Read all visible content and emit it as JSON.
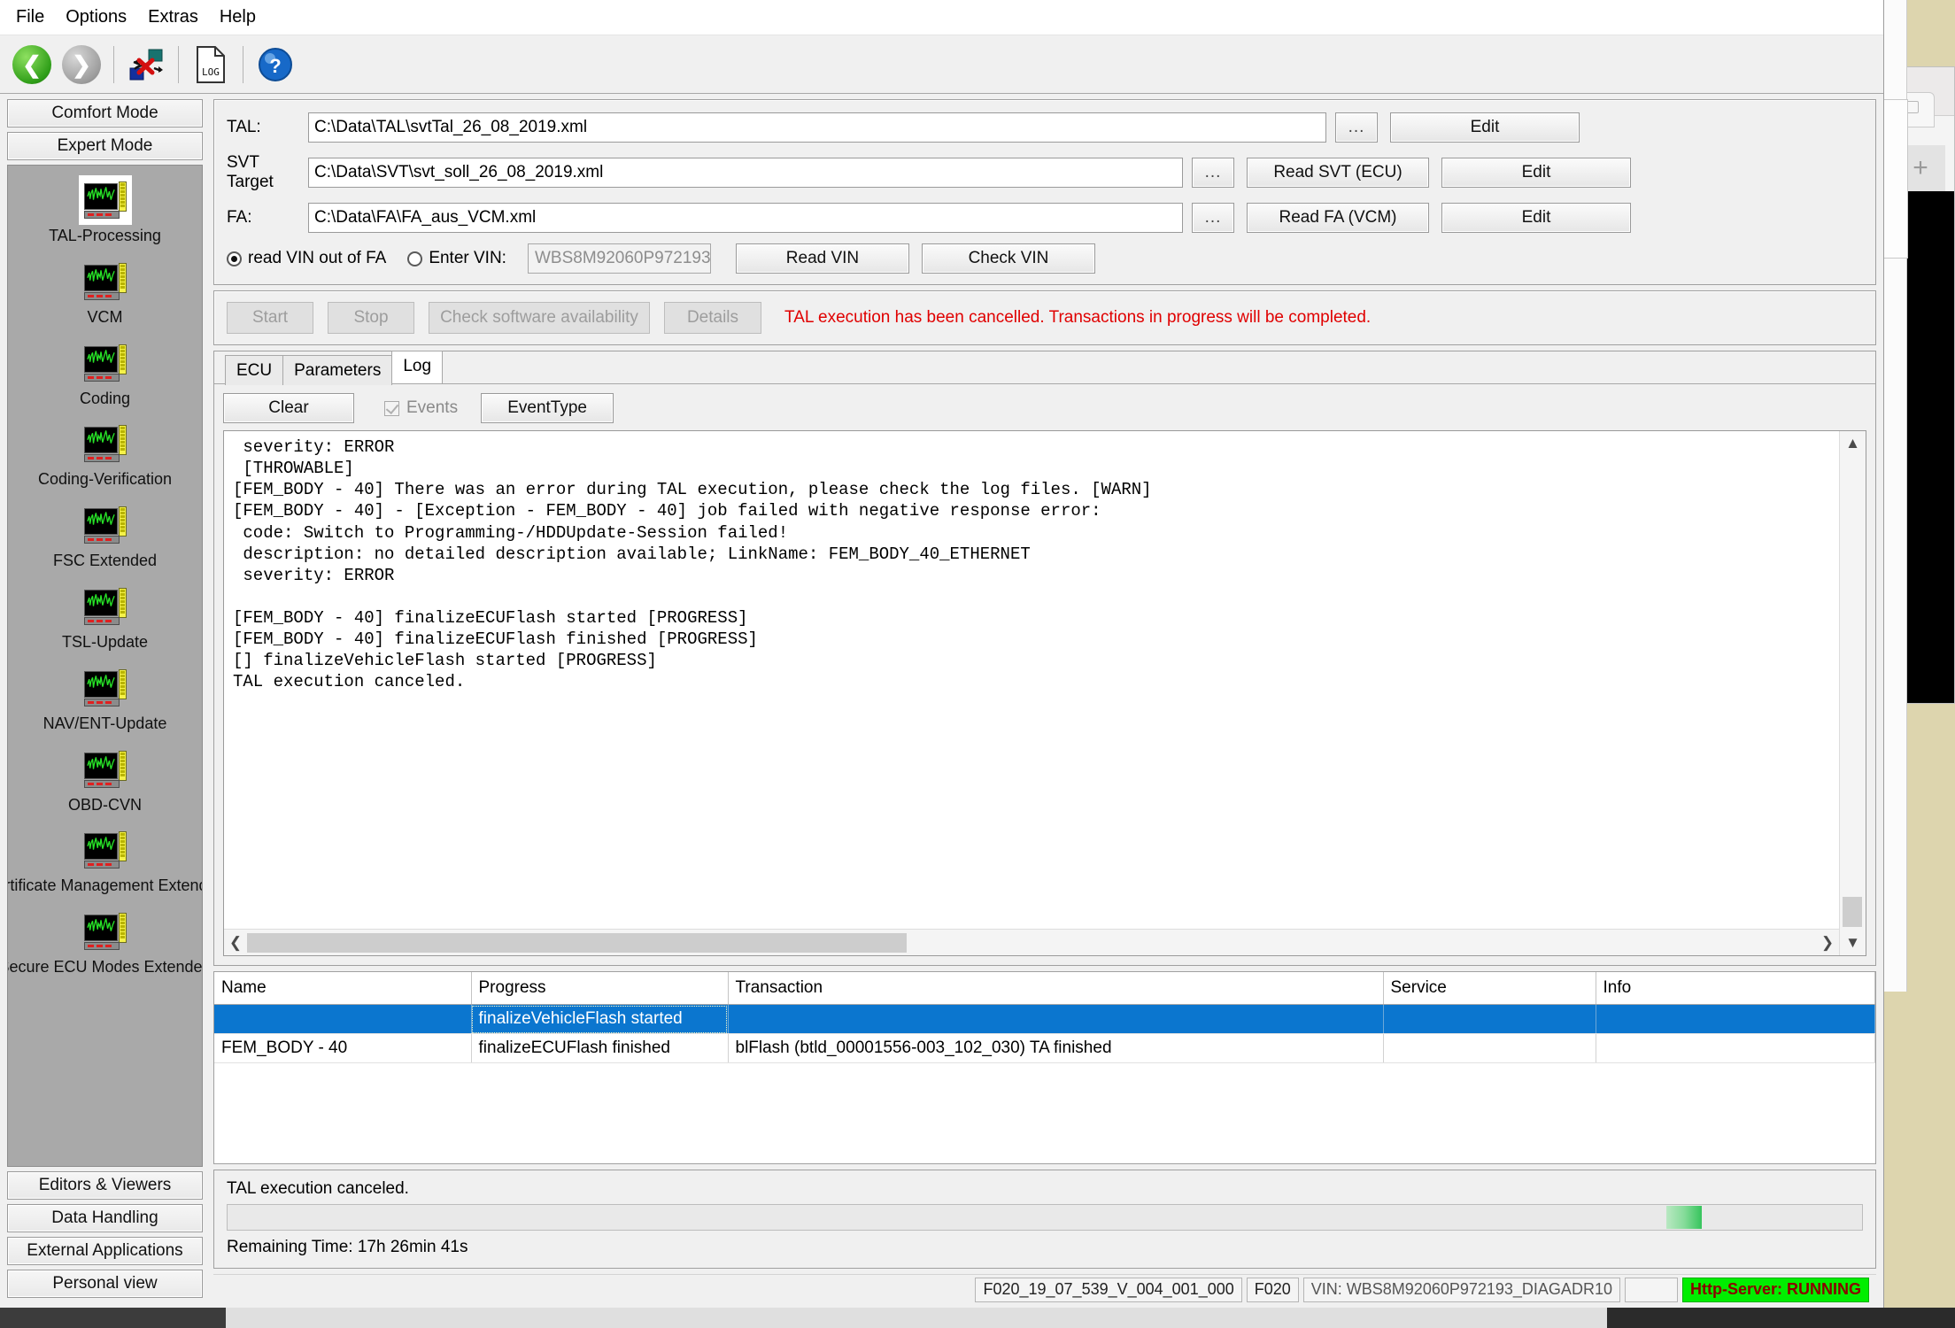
{
  "menu": {
    "items": [
      "File",
      "Options",
      "Extras",
      "Help"
    ]
  },
  "toolbar": {
    "back_icon": "back-arrow-icon",
    "forward_icon": "forward-arrow-icon",
    "network_icon": "connection-error-icon",
    "log_icon": "log-document-icon",
    "help_icon": "help-icon"
  },
  "sidebar": {
    "top_buttons": [
      {
        "label": "Comfort Mode"
      },
      {
        "label": "Expert Mode"
      }
    ],
    "items": [
      {
        "label": "TAL-Processing",
        "selected": true
      },
      {
        "label": "VCM",
        "selected": false
      },
      {
        "label": "Coding",
        "selected": false
      },
      {
        "label": "Coding-Verification",
        "selected": false
      },
      {
        "label": "FSC Extended",
        "selected": false
      },
      {
        "label": "TSL-Update",
        "selected": false
      },
      {
        "label": "NAV/ENT-Update",
        "selected": false
      },
      {
        "label": "OBD-CVN",
        "selected": false
      },
      {
        "label": "Certificate Management Extended",
        "selected": false
      },
      {
        "label": "Secure ECU Modes Extended",
        "selected": false
      }
    ],
    "bottom_buttons": [
      {
        "label": "Editors & Viewers"
      },
      {
        "label": "Data Handling"
      },
      {
        "label": "External Applications"
      },
      {
        "label": "Personal view"
      }
    ]
  },
  "file_panel": {
    "tal": {
      "label": "TAL:",
      "value": "C:\\Data\\TAL\\svtTal_26_08_2019.xml",
      "browse_label": "...",
      "edit_label": "Edit"
    },
    "svt": {
      "label": "SVT Target",
      "value": "C:\\Data\\SVT\\svt_soll_26_08_2019.xml",
      "browse_label": "...",
      "read_label": "Read SVT (ECU)",
      "edit_label": "Edit"
    },
    "fa": {
      "label": "FA:",
      "value": "C:\\Data\\FA\\FA_aus_VCM.xml",
      "browse_label": "...",
      "read_label": "Read FA (VCM)",
      "edit_label": "Edit"
    },
    "vin_row": {
      "radio_read_label": "read VIN out of FA",
      "radio_read_selected": true,
      "radio_enter_label": "Enter VIN:",
      "radio_enter_selected": false,
      "vin_placeholder": "WBS8M92060P972193",
      "read_vin_label": "Read VIN",
      "check_vin_label": "Check VIN"
    }
  },
  "action_bar": {
    "start_label": "Start",
    "stop_label": "Stop",
    "check_software_label": "Check software availability",
    "details_label": "Details",
    "error_message": "TAL execution has been cancelled. Transactions in progress will be completed.",
    "error_color": "#e00000"
  },
  "tabs": {
    "items": [
      {
        "label": "ECU",
        "active": false
      },
      {
        "label": "Parameters",
        "active": false
      },
      {
        "label": "Log",
        "active": true
      }
    ]
  },
  "log_toolbar": {
    "clear_label": "Clear",
    "events_label": "Events",
    "events_checked": true,
    "eventtype_label": "EventType"
  },
  "log": {
    "text": " severity: ERROR\n [THROWABLE]\n[FEM_BODY - 40] There was an error during TAL execution, please check the log files. [WARN]\n[FEM_BODY - 40] - [Exception - FEM_BODY - 40] job failed with negative response error:\n code: Switch to Programming-/HDDUpdate-Session failed!\n description: no detailed description available; LinkName: FEM_BODY_40_ETHERNET\n severity: ERROR\n\n[FEM_BODY - 40] finalizeECUFlash started [PROGRESS]\n[FEM_BODY - 40] finalizeECUFlash finished [PROGRESS]\n[] finalizeVehicleFlash started [PROGRESS]\nTAL execution canceled.",
    "scroll_up_icon": "chevron-up-icon",
    "scroll_down_icon": "chevron-down-icon",
    "scroll_left_icon": "chevron-left-icon",
    "scroll_right_icon": "chevron-right-icon"
  },
  "table": {
    "columns": [
      "Name",
      "Progress",
      "Transaction",
      "Service",
      "Info"
    ],
    "rows": [
      {
        "selected": true,
        "cells": [
          "",
          "finalizeVehicleFlash started",
          "",
          "",
          ""
        ]
      },
      {
        "selected": false,
        "cells": [
          "FEM_BODY - 40",
          "finalizeECUFlash finished",
          "blFlash (btld_00001556-003_102_030) TA finished",
          "",
          ""
        ]
      }
    ]
  },
  "status_block": {
    "status_text": "TAL execution canceled.",
    "remaining_label": "Remaining Time:  17h 26min 41s",
    "progress_color": "#36c45c"
  },
  "statusbar": {
    "version": "F020_19_07_539_V_004_001_000",
    "series": "F020",
    "vin": "VIN: WBS8M92060P972193_DIAGADR10",
    "spacer": "",
    "http_server": "Http-Server: RUNNING",
    "http_bg": "#00ee00"
  },
  "background": {
    "plus_tab_icon": "plus-icon"
  }
}
